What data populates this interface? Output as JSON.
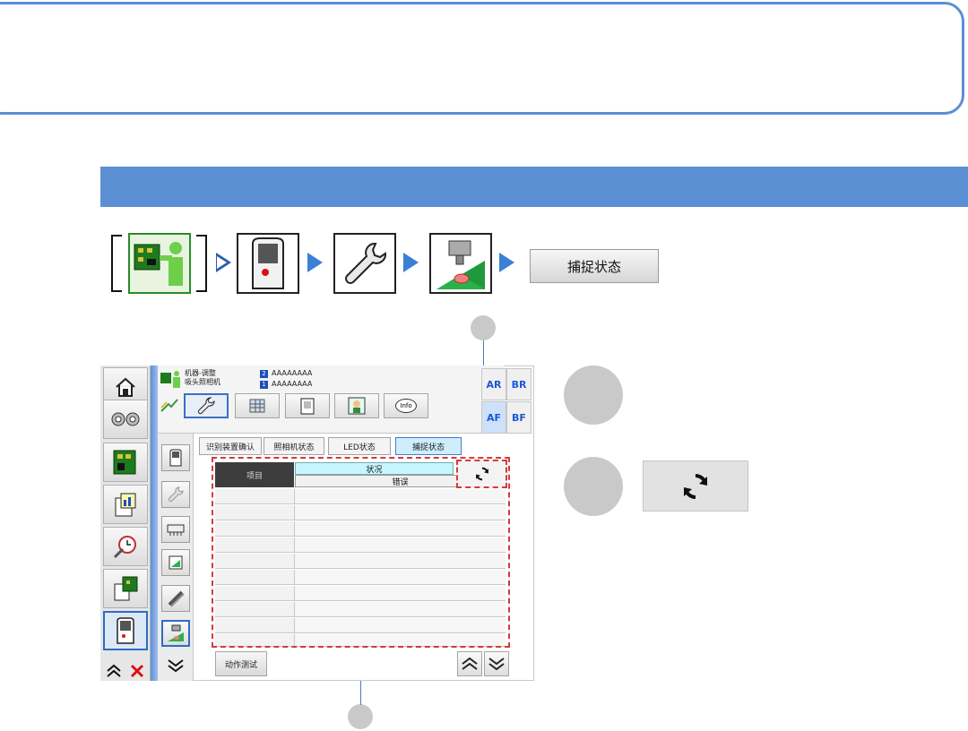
{
  "breadcrumb": {
    "status_button_label": "捕捉状态"
  },
  "screen": {
    "header": {
      "mode_line1": "机器-调整",
      "mode_line2": "吸头照相机",
      "badge1": "2",
      "badge2": "1",
      "value1": "AAAAAAAA",
      "value2": "AAAAAAAA"
    },
    "corner_buttons": [
      "AR",
      "BR",
      "AF",
      "BF"
    ],
    "tool_info_label": "Info",
    "tabs": [
      "识别装置确认",
      "照相机状态",
      "LED状态",
      "捕捉状态"
    ],
    "active_tab": "捕捉状态",
    "table": {
      "item_header": "项目",
      "status_header": "状况",
      "error_header": "错误",
      "rows": 10
    },
    "action_button_label": "动作测试"
  },
  "colors": {
    "accent_blue": "#5b8fd3",
    "highlight_red": "#d43a3a",
    "active_tab": "#cfeefd"
  },
  "icons": {
    "home": "home-icon",
    "gears": "gears-icon",
    "board": "circuit-board-icon",
    "report": "report-chart-icon",
    "alarm": "alarm-clock-icon",
    "machine": "machine-icon",
    "camera": "camera-unit-icon",
    "wrench": "wrench-icon",
    "stage": "stage-icon",
    "refresh": "refresh-icon"
  }
}
